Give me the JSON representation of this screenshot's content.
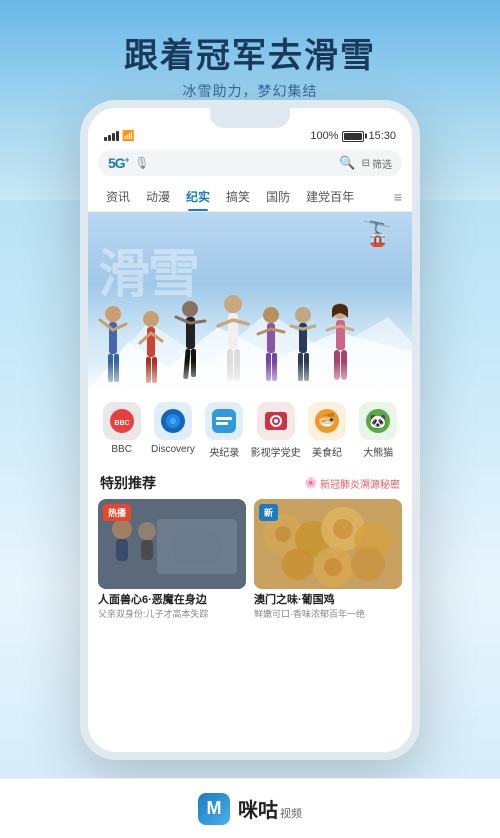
{
  "app": {
    "title": "咪咕视频",
    "logo_m": "M",
    "logo_text": "咪咕",
    "logo_sub": "视频"
  },
  "hero": {
    "title": "跟着冠军去滑雪",
    "subtitle": "冰雪助力，梦幻集结"
  },
  "status_bar": {
    "signal": "..l",
    "wifi": "wifi",
    "battery": "100%",
    "time": "15:30"
  },
  "search": {
    "logo": "5G",
    "logo_sup": "+",
    "filter_label": "筛选"
  },
  "nav_tabs": [
    {
      "label": "资讯",
      "active": false
    },
    {
      "label": "动漫",
      "active": false
    },
    {
      "label": "纪实",
      "active": true
    },
    {
      "label": "搞笑",
      "active": false
    },
    {
      "label": "国防",
      "active": false
    },
    {
      "label": "建党百年",
      "active": false
    }
  ],
  "banner": {
    "bg_text": "滑雪"
  },
  "categories": [
    {
      "label": "BBC",
      "color": "#e84040",
      "icon": "📺"
    },
    {
      "label": "Discovery",
      "color": "#2277cc",
      "icon": "🔵"
    },
    {
      "label": "央纪录",
      "color": "#3399dd",
      "icon": "🎬"
    },
    {
      "label": "影视学党史",
      "color": "#cc3344",
      "icon": "📷"
    },
    {
      "label": "美食纪",
      "color": "#dd9922",
      "icon": "🍜"
    },
    {
      "label": "大熊猫",
      "color": "#55aa44",
      "icon": "🐼"
    }
  ],
  "section": {
    "title": "特别推荐",
    "notice_icon": "🌸",
    "notice_text": "新冠肺炎溯源秘密"
  },
  "cards": [
    {
      "badge": "热播",
      "badge_type": "hot",
      "title": "人面兽心6·恶魔在身边",
      "desc": "父亲双身份:儿子才高本失踪"
    },
    {
      "badge": "新",
      "badge_type": "new",
      "title": "澳门之味·葡国鸡",
      "desc": "鲜嫩可口·香味浓郁百年一绝"
    }
  ],
  "gondola_icon": "🚡"
}
